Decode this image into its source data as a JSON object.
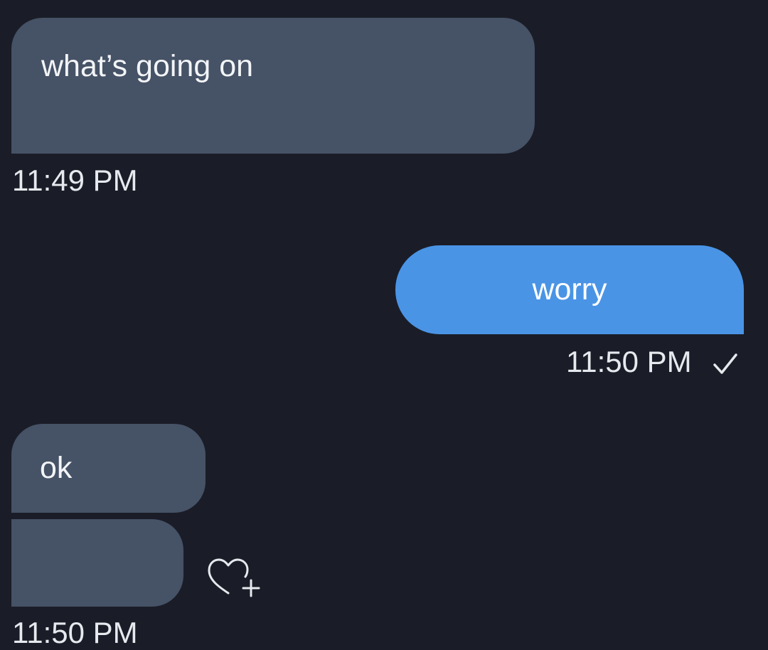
{
  "conversation": {
    "messages": [
      {
        "direction": "incoming",
        "text": "what’s going on",
        "time": "11:49 PM"
      },
      {
        "direction": "outgoing",
        "text": "worry",
        "time": "11:50 PM",
        "status_icon": "check-icon"
      },
      {
        "direction": "incoming",
        "text": "ok"
      },
      {
        "direction": "incoming",
        "text": "",
        "time": "11:50 PM",
        "reaction_icon": "heart-plus-icon"
      }
    ]
  },
  "colors": {
    "background": "#1a1d27",
    "incoming_bubble": "#465266",
    "outgoing_bubble": "#4a94e6",
    "text": "#e6e9ee"
  }
}
